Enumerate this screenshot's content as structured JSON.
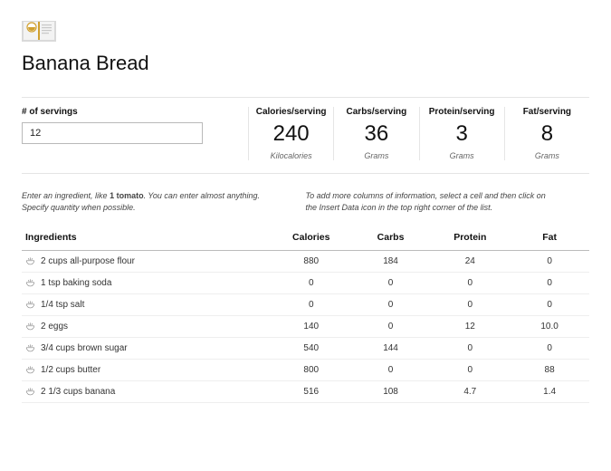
{
  "title": "Banana Bread",
  "servings": {
    "label": "# of servings",
    "value": "12"
  },
  "stats": [
    {
      "label": "Calories/serving",
      "value": "240",
      "unit": "Kilocalories"
    },
    {
      "label": "Carbs/serving",
      "value": "36",
      "unit": "Grams"
    },
    {
      "label": "Protein/serving",
      "value": "3",
      "unit": "Grams"
    },
    {
      "label": "Fat/serving",
      "value": "8",
      "unit": "Grams"
    }
  ],
  "hints": {
    "left_pre": "Enter an ingredient, like ",
    "left_bold": "1 tomato",
    "left_post": ". You can enter almost anything. Specify quantity when possible.",
    "right": "To add more columns of information, select a cell and then click on the Insert Data icon in the top right corner of the list."
  },
  "columns": {
    "ingredients": "Ingredients",
    "calories": "Calories",
    "carbs": "Carbs",
    "protein": "Protein",
    "fat": "Fat"
  },
  "rows": [
    {
      "name": "2 cups all-purpose flour",
      "calories": "880",
      "carbs": "184",
      "protein": "24",
      "fat": "0"
    },
    {
      "name": "1 tsp baking soda",
      "calories": "0",
      "carbs": "0",
      "protein": "0",
      "fat": "0"
    },
    {
      "name": "1/4 tsp salt",
      "calories": "0",
      "carbs": "0",
      "protein": "0",
      "fat": "0"
    },
    {
      "name": "2 eggs",
      "calories": "140",
      "carbs": "0",
      "protein": "12",
      "fat": "10.0"
    },
    {
      "name": "3/4 cups brown sugar",
      "calories": "540",
      "carbs": "144",
      "protein": "0",
      "fat": "0"
    },
    {
      "name": "1/2 cups butter",
      "calories": "800",
      "carbs": "0",
      "protein": "0",
      "fat": "88"
    },
    {
      "name": "2 1/3 cups banana",
      "calories": "516",
      "carbs": "108",
      "protein": "4.7",
      "fat": "1.4"
    }
  ]
}
